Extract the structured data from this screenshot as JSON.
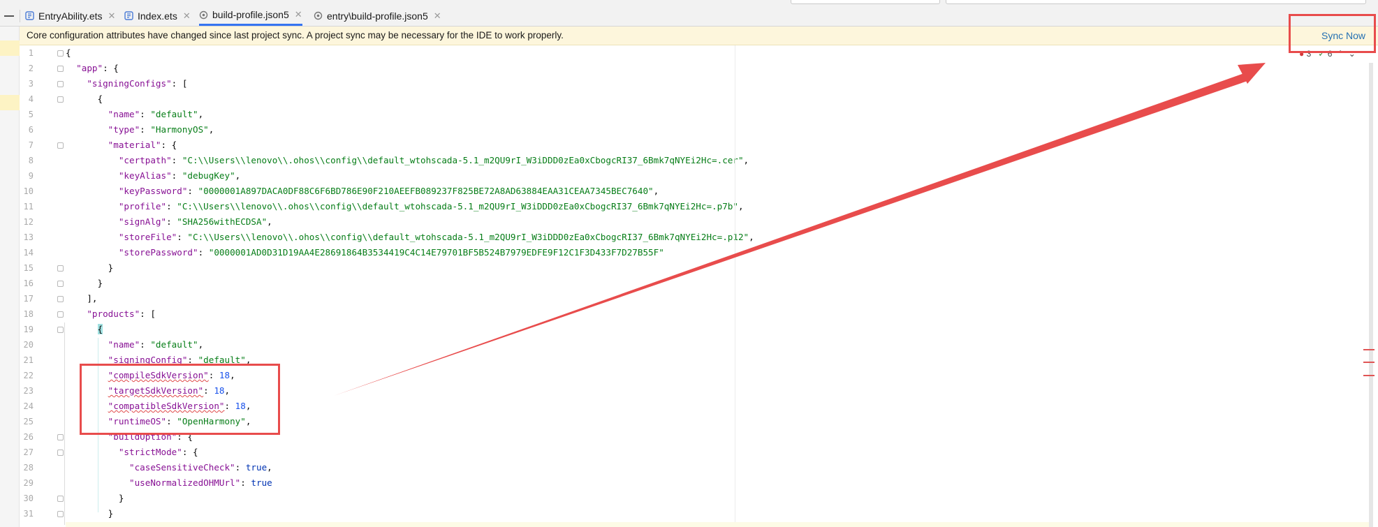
{
  "tabs": [
    {
      "label": "EntryAbility.ets",
      "active": false
    },
    {
      "label": "Index.ets",
      "active": false
    },
    {
      "label": "build-profile.json5",
      "active": true
    },
    {
      "label": "entry\\build-profile.json5",
      "active": false
    }
  ],
  "notification": {
    "message": "Core configuration attributes have changed since last project sync. A project sync may be necessary for the IDE to work properly.",
    "action": "Sync Now"
  },
  "inspections": {
    "errors": "3",
    "typos": "6",
    "warn_icon": "error-circle-icon",
    "typo_icon": "typo-icon"
  },
  "editor": {
    "line_numbers": [
      "1",
      "2",
      "3",
      "4",
      "5",
      "6",
      "7",
      "8",
      "9",
      "10",
      "11",
      "12",
      "13",
      "14",
      "15",
      "16",
      "17",
      "18",
      "19",
      "20",
      "21",
      "22",
      "23",
      "24",
      "25",
      "26",
      "27",
      "28",
      "29",
      "30",
      "31"
    ],
    "lines": [
      "{",
      "  \"app\": {",
      "    \"signingConfigs\": [",
      "      {",
      "        \"name\": \"default\",",
      "        \"type\": \"HarmonyOS\",",
      "        \"material\": {",
      "          \"certpath\": \"C:\\\\Users\\\\lenovo\\\\.ohos\\\\config\\\\default_wtohscada-5.1_m2QU9rI_W3iDDD0zEa0xCbogcRI37_6Bmk7qNYEi2Hc=.cer\",",
      "          \"keyAlias\": \"debugKey\",",
      "          \"keyPassword\": \"0000001A897DACA0DF88C6F6BD786E90F210AEEFB089237F825BE72A8AD63884EAA31CEAA7345BEC7640\",",
      "          \"profile\": \"C:\\\\Users\\\\lenovo\\\\.ohos\\\\config\\\\default_wtohscada-5.1_m2QU9rI_W3iDDD0zEa0xCbogcRI37_6Bmk7qNYEi2Hc=.p7b\",",
      "          \"signAlg\": \"SHA256withECDSA\",",
      "          \"storeFile\": \"C:\\\\Users\\\\lenovo\\\\.ohos\\\\config\\\\default_wtohscada-5.1_m2QU9rI_W3iDDD0zEa0xCbogcRI37_6Bmk7qNYEi2Hc=.p12\",",
      "          \"storePassword\": \"0000001AD0D31D19AA4E28691864B3534419C4C14E79701BF5B524B7979EDFE9F12C1F3D433F7D27B55F\"",
      "        }",
      "      }",
      "    ],",
      "    \"products\": [",
      "      {",
      "        \"name\": \"default\",",
      "        \"signingConfig\": \"default\",",
      "        \"compileSdkVersion\": 18,",
      "        \"targetSdkVersion\": 18,",
      "        \"compatibleSdkVersion\": 18,",
      "        \"runtimeOS\": \"OpenHarmony\",",
      "        \"buildOption\": {",
      "          \"strictMode\": {",
      "            \"caseSensitiveCheck\": true,",
      "            \"useNormalizedOHMUrl\": true",
      "          }",
      "        }"
    ]
  }
}
